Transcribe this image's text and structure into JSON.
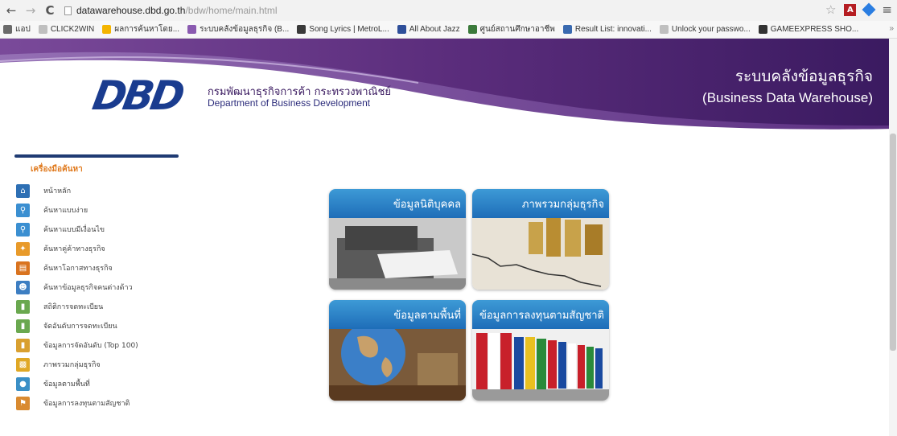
{
  "browser": {
    "url_host": "datawarehouse.dbd.go.th",
    "url_path": "/bdw/home/main.html",
    "back_icon": "arrow-left",
    "forward_icon": "arrow-right",
    "reload_icon": "reload",
    "bookmarks": [
      {
        "label": "แอป",
        "color": "#6a6a6a"
      },
      {
        "label": "CLICK2WIN",
        "color": "#bfbfbf"
      },
      {
        "label": "ผลการค้นหาโดย...",
        "color": "#f4b400"
      },
      {
        "label": "ระบบคลังข้อมูลธุรกิจ (B...",
        "color": "#8a5ab0"
      },
      {
        "label": "Song Lyrics | MetroL...",
        "color": "#3a3a3a"
      },
      {
        "label": "All About Jazz",
        "color": "#2e4f9a"
      },
      {
        "label": "ศูนย์สถานศึกษาอาชีพ",
        "color": "#3b7a3b"
      },
      {
        "label": "Result List: innovati...",
        "color": "#3a6ab0"
      },
      {
        "label": "Unlock your passwo...",
        "color": "#bfbfbf"
      },
      {
        "label": "GAMEEXPRESS SHO...",
        "color": "#333333"
      }
    ],
    "more": "»"
  },
  "banner": {
    "logo": "DBD",
    "org_th": "กรมพัฒนาธุรกิจการค้า กระทรวงพาณิชย์",
    "org_en": "Department of Business Development",
    "site_th": "ระบบคลังข้อมูลธุรกิจ",
    "site_en": "(Business Data Warehouse)"
  },
  "sidebar": {
    "title": "เครื่องมือค้นหา",
    "items": [
      {
        "label": "หน้าหลัก",
        "color": "#2d6fb4",
        "glyph": "⌂",
        "icon": "home-icon"
      },
      {
        "label": "ค้นหาแบบง่าย",
        "color": "#3b8fd1",
        "glyph": "⚲",
        "icon": "search-icon"
      },
      {
        "label": "ค้นหาแบบมีเงื่อนไข",
        "color": "#3b8fd1",
        "glyph": "⚲",
        "icon": "search-advanced-icon"
      },
      {
        "label": "ค้นหาคู่ค้าทางธุรกิจ",
        "color": "#e89a2a",
        "glyph": "✦",
        "icon": "partner-icon"
      },
      {
        "label": "ค้นหาโอกาสทางธุรกิจ",
        "color": "#d9731f",
        "glyph": "▤",
        "icon": "briefcase-icon"
      },
      {
        "label": "ค้นหาข้อมูลธุรกิจคนต่างด้าว",
        "color": "#3d7ec2",
        "glyph": "☻",
        "icon": "person-icon"
      },
      {
        "label": "สถิติการจดทะเบียน",
        "color": "#6aa84f",
        "glyph": "▮",
        "icon": "chart-icon"
      },
      {
        "label": "จัดอันดับการจดทะเบียน",
        "color": "#6aa84f",
        "glyph": "▮",
        "icon": "ranking-icon"
      },
      {
        "label": "ข้อมูลการจัดอันดับ (Top 100)",
        "color": "#d9a030",
        "glyph": "▮",
        "icon": "top100-icon"
      },
      {
        "label": "ภาพรวมกลุ่มธุรกิจ",
        "color": "#e0a825",
        "glyph": "▩",
        "icon": "overview-icon"
      },
      {
        "label": "ข้อมูลตามพื้นที่",
        "color": "#3a8fc6",
        "glyph": "●",
        "icon": "globe-icon"
      },
      {
        "label": "ข้อมูลการลงทุนตามสัญชาติ",
        "color": "#d98a30",
        "glyph": "⚑",
        "icon": "flag-icon"
      }
    ]
  },
  "tiles": [
    {
      "label": "ข้อมูลนิติบุคคล",
      "name": "tile-juristic"
    },
    {
      "label": "ภาพรวมกลุ่มธุรกิจ",
      "name": "tile-business-overview"
    },
    {
      "label": "ข้อมูลตามพื้นที่",
      "name": "tile-by-area"
    },
    {
      "label": "ข้อมูลการลงทุนตามสัญชาติ",
      "name": "tile-investment-nationality"
    }
  ]
}
